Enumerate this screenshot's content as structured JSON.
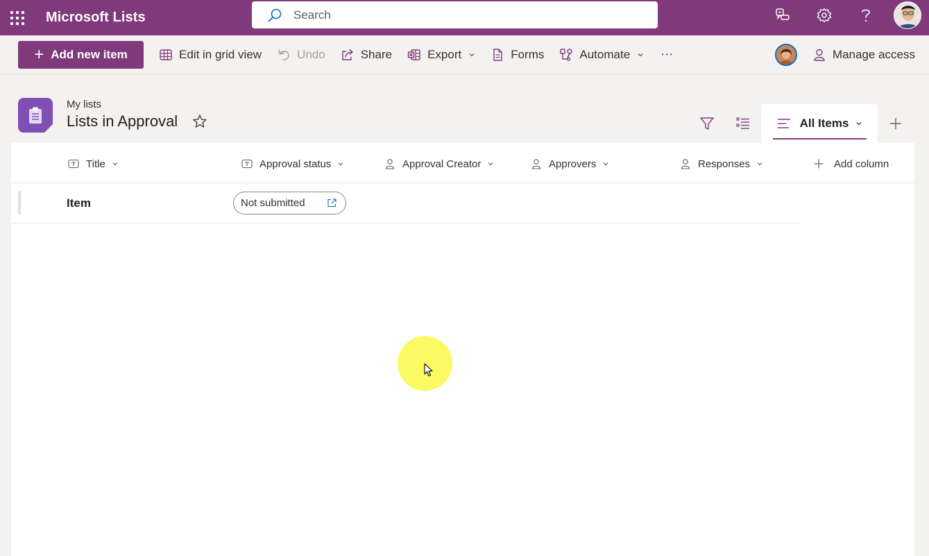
{
  "suite_bar": {
    "app_name": "Microsoft Lists",
    "search_placeholder": "Search",
    "icons": [
      "waffle-icon",
      "search-icon",
      "feedback-icon",
      "gear-icon",
      "help-icon",
      "avatar"
    ]
  },
  "command_bar": {
    "add_new_item": "Add new item",
    "edit_grid": "Edit in grid view",
    "undo": "Undo",
    "share": "Share",
    "export": "Export",
    "forms": "Forms",
    "automate": "Automate",
    "more": "⋯",
    "manage_access": "Manage access"
  },
  "header": {
    "breadcrumb": "My lists",
    "title": "Lists in Approval"
  },
  "view": {
    "current_view": "All Items"
  },
  "columns": [
    {
      "label": "Title",
      "type": "text"
    },
    {
      "label": "Approval status",
      "type": "text"
    },
    {
      "label": "Approval Creator",
      "type": "person"
    },
    {
      "label": "Approvers",
      "type": "person"
    },
    {
      "label": "Responses",
      "type": "person"
    }
  ],
  "add_column": "Add column",
  "rows": [
    {
      "title": "Item",
      "approval_status": "Not submitted"
    }
  ],
  "colors": {
    "brand": "#80397b",
    "list_icon": "#7f4fb4",
    "cursor_highlight": "#fbfa5a"
  }
}
